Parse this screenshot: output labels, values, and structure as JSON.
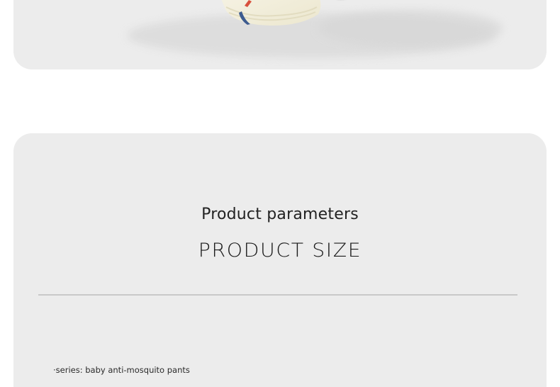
{
  "params": {
    "heading": "Product parameters",
    "subheading": "PRODUCT SIZE",
    "series_line": "·series: baby anti-mosquito pants"
  },
  "colors": {
    "card_background": "#ececec",
    "page_background": "#ffffff",
    "divider": "#c9c9c9",
    "text": "#222222"
  }
}
